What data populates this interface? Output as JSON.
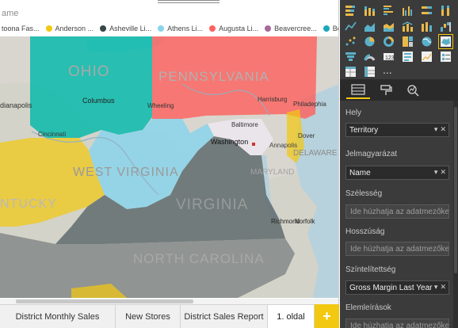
{
  "canvas": {
    "field_name_partial": "ame",
    "legend": [
      {
        "label": "toona Fas...",
        "color": "#f2c811"
      },
      {
        "label": "Anderson ...",
        "color": "#374649"
      },
      {
        "label": "Asheville Li...",
        "color": "#8ad4eb"
      },
      {
        "label": "Athens Li...",
        "color": "#fd625e"
      },
      {
        "label": "Augusta Li...",
        "color": "#a66999"
      },
      {
        "label": "Beavercree...",
        "color": "#1aa8bb"
      },
      {
        "label": "Beckle",
        "color": ""
      }
    ],
    "map_labels": {
      "ohio": "OHIO",
      "pennsylvania": "PENNSYLVANIA",
      "west_virginia": "WEST VIRGINIA",
      "virginia": "VIRGINIA",
      "north_carolina": "NORTH CAROLINA",
      "kentucky": "NTUCKY",
      "delaware": "DELAWARE",
      "maryland": "MARYLAND",
      "indianapolis": "dianapolis",
      "columbus": "Columbus",
      "cincinnati": "Cincinnati",
      "wheeling": "Wheeling",
      "harrisburg": "Harrisburg",
      "baltimore": "Baltimore",
      "philadelphia": "Philade­phia",
      "dover": "Dover",
      "washington": "Washington",
      "annapolis": "Annapolis",
      "richmond": "Richmond",
      "norfolk": "Norfolk"
    }
  },
  "page_tabs": [
    {
      "label": "District Monthly Sales",
      "active": false
    },
    {
      "label": "New Stores",
      "active": false
    },
    {
      "label": "District Sales Report",
      "active": false
    },
    {
      "label": "1. oldal",
      "active": true
    }
  ],
  "add_page_label": "+",
  "panel": {
    "more_visuals": "...",
    "wells": [
      {
        "label": "Hely",
        "value": "Territory",
        "placeholder": ""
      },
      {
        "label": "Jelmagyarázat",
        "value": "Name",
        "placeholder": ""
      },
      {
        "label": "Szélesség",
        "value": "",
        "placeholder": "Ide húzhatja az adatmezőket"
      },
      {
        "label": "Hosszúság",
        "value": "",
        "placeholder": "Ide húzhatja az adatmezőket"
      },
      {
        "label": "Színtelítettség",
        "value": "Gross Margin Last Year %",
        "placeholder": ""
      },
      {
        "label": "Elemleírások",
        "value": "",
        "placeholder": "Ide húzhatja az adatmezőket"
      }
    ],
    "field_ctrl_arrow": "▾",
    "field_ctrl_remove": "✕"
  },
  "colors": {
    "accent": "#f2c811",
    "panel_bg": "#3b3b3b",
    "ohio": "#01b8aa",
    "pennsylvania": "#fd625e",
    "west_virginia": "#8ad4eb",
    "kentucky": "#f2c811",
    "virginia_nc": "#5f6b6d"
  }
}
